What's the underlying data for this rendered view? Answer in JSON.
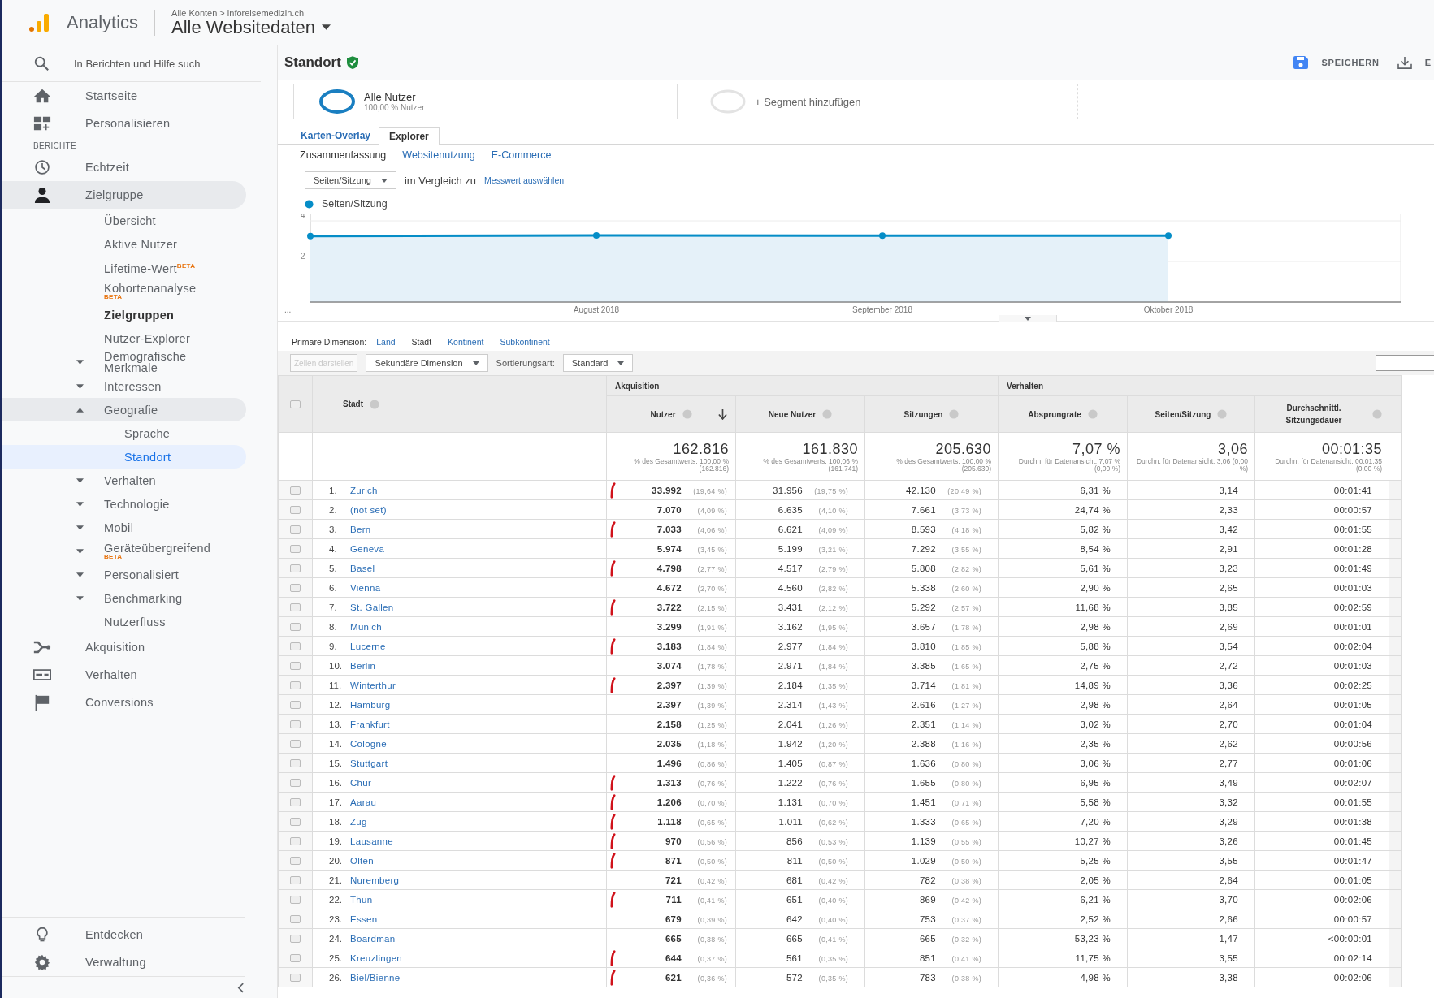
{
  "header": {
    "product": "Analytics",
    "breadcrumb": "Alle Konten > inforeisemedizin.ch",
    "view": "Alle Websitedaten"
  },
  "sidebar": {
    "search_placeholder": "In Berichten und Hilfe such",
    "nav": [
      {
        "kind": "item",
        "label": "Startseite",
        "selected": false
      },
      {
        "kind": "item",
        "label": "Personalisieren",
        "selected": false
      },
      {
        "kind": "section",
        "label": "BERICHTE"
      },
      {
        "kind": "item",
        "label": "Echtzeit",
        "expanded": false,
        "selected": false
      },
      {
        "kind": "item",
        "label": "Zielgruppe",
        "expanded": true,
        "selected": false,
        "children": [
          {
            "label": "Übersicht",
            "selected": false
          },
          {
            "label": "Aktive Nutzer",
            "selected": false
          },
          {
            "label": "Lifetime-Wert$^{BETA}$",
            "selected": false
          },
          {
            "label": "Kohortenanalyse",
            "badge": "BETA",
            "selected": false
          },
          {
            "label": "Zielgruppen",
            "bold": true,
            "selected": false
          },
          {
            "label": "Nutzer-Explorer",
            "selected": false
          },
          {
            "label": "Demografische Merkmale",
            "expanded": false,
            "selected": false
          },
          {
            "label": "Interessen",
            "expanded": false,
            "selected": false
          },
          {
            "label": "Geografie",
            "expanded": true,
            "selected": false,
            "children": [
              {
                "label": "Sprache",
                "selected": false
              },
              {
                "label": "Standort",
                "selected": true
              }
            ]
          },
          {
            "label": "Verhalten",
            "expanded": false,
            "selected": false
          },
          {
            "label": "Technologie",
            "expanded": false,
            "selected": false
          },
          {
            "label": "Mobil",
            "expanded": false,
            "selected": false
          },
          {
            "label": "Geräteübergreifend",
            "badge": "BETA",
            "expanded": false,
            "selected": false
          },
          {
            "label": "Personalisiert",
            "expanded": false,
            "selected": false
          },
          {
            "label": "Benchmarking",
            "expanded": false,
            "selected": false
          },
          {
            "label": "Nutzerfluss",
            "selected": false
          }
        ]
      },
      {
        "kind": "item",
        "label": "Akquisition",
        "expanded": false,
        "selected": false
      },
      {
        "kind": "item",
        "label": "Verhalten",
        "expanded": false,
        "selected": false
      },
      {
        "kind": "item",
        "label": "Conversions",
        "expanded": false,
        "selected": false
      }
    ],
    "bottom": [
      {
        "label": "Entdecken"
      },
      {
        "label": "Verwaltung"
      }
    ]
  },
  "page": {
    "title": "Standort",
    "actions": [
      {
        "label": "SPEICHERN"
      },
      {
        "label": "E"
      }
    ]
  },
  "segments": [
    {
      "kind": "active",
      "label": "Alle Nutzer",
      "sublabel": "100,00 % Nutzer"
    },
    {
      "kind": "add",
      "label": "+ Segment hinzufügen"
    }
  ],
  "view_tabs": [
    {
      "label": "Karten-Overlay",
      "selected": false
    },
    {
      "label": "Explorer",
      "selected": true
    }
  ],
  "sub_tabs": [
    {
      "label": "Zusammenfassung",
      "selected": true
    },
    {
      "label": "Websitenutzung",
      "selected": false
    },
    {
      "label": "E-Commerce",
      "selected": false
    }
  ],
  "metric": {
    "select": "Seiten/Sitzung",
    "compare_text": "im Vergleich zu",
    "compare_link": "Messwert auswählen"
  },
  "chart_data": {
    "type": "area",
    "categories": [
      "...",
      "August 2018",
      "September 2018",
      "Oktober 2018"
    ],
    "ylim": [
      0,
      4.36
    ],
    "yticks": [
      2,
      4
    ],
    "series": [
      {
        "name": "Seiten/Sitzung",
        "color": "#058dc7",
        "marker": true,
        "values": [
          3.25,
          3.28,
          3.27,
          3.27
        ]
      }
    ]
  },
  "primary_dimension": {
    "label": "Primäre Dimension:",
    "options": [
      {
        "label": "Land",
        "selected": false
      },
      {
        "label": "Stadt",
        "selected": true
      },
      {
        "label": "Kontinent",
        "selected": false
      },
      {
        "label": "Subkontinent",
        "selected": false
      }
    ]
  },
  "toolbar": {
    "rows_button": {
      "label": "Zeilen darstellen",
      "disabled": true
    },
    "secondary": "Sekundäre Dimension",
    "sort_label": "Sortierungsart:",
    "sort": "Standard"
  },
  "table": {
    "header_checked": false,
    "dimension": "Stadt",
    "groups": [
      {
        "label": "Akquisition"
      },
      {
        "label": "Verhalten"
      }
    ],
    "columns": [
      {
        "label": "Nutzer",
        "sorted": true
      },
      {
        "label": "Neue Nutzer",
        "sorted": false
      },
      {
        "label": "Sitzungen",
        "sorted": false
      },
      {
        "label": "Absprungrate",
        "sorted": false
      },
      {
        "label": "Seiten/Sitzung",
        "sorted": false
      },
      {
        "label": "Durchschnittl. Sitzungsdauer",
        "sorted": false
      }
    ],
    "totals": [
      {
        "value": "162.816",
        "note": "% des Gesamtwerts: 100,00 % (162.816)"
      },
      {
        "value": "161.830",
        "note": "% des Gesamtwerts: 100,06 % (161.741)"
      },
      {
        "value": "205.630",
        "note": "% des Gesamtwerts: 100,00 % (205.630)"
      },
      {
        "value": "7,07 %",
        "note": "Durchn. für Datenansicht: 7,07 % (0,00 %)"
      },
      {
        "value": "3,06",
        "note": "Durchn. für Datenansicht: 3,06 (0,00 %)"
      },
      {
        "value": "00:01:35",
        "note": "Durchn. für Datenansicht: 00:01:35 (0,00 %)"
      }
    ],
    "rows": [
      {
        "index": "1.",
        "city": "Zurich",
        "users": "33.992",
        "users_pct": "(19,64 %)",
        "new_users": "31.956",
        "new_users_pct": "(19,75 %)",
        "sessions": "42.130",
        "sessions_pct": "(20,49 %)",
        "bounce": "6,31 %",
        "pages": "3,14",
        "duration": "00:01:41",
        "checked": false,
        "marked": true
      },
      {
        "index": "2.",
        "city": "(not set)",
        "users": "7.070",
        "users_pct": "(4,09 %)",
        "new_users": "6.635",
        "new_users_pct": "(4,10 %)",
        "sessions": "7.661",
        "sessions_pct": "(3,73 %)",
        "bounce": "24,74 %",
        "pages": "2,33",
        "duration": "00:00:57",
        "checked": false,
        "marked": false
      },
      {
        "index": "3.",
        "city": "Bern",
        "users": "7.033",
        "users_pct": "(4,06 %)",
        "new_users": "6.621",
        "new_users_pct": "(4,09 %)",
        "sessions": "8.593",
        "sessions_pct": "(4,18 %)",
        "bounce": "5,82 %",
        "pages": "3,42",
        "duration": "00:01:55",
        "checked": false,
        "marked": true
      },
      {
        "index": "4.",
        "city": "Geneva",
        "users": "5.974",
        "users_pct": "(3,45 %)",
        "new_users": "5.199",
        "new_users_pct": "(3,21 %)",
        "sessions": "7.292",
        "sessions_pct": "(3,55 %)",
        "bounce": "8,54 %",
        "pages": "2,91",
        "duration": "00:01:28",
        "checked": false,
        "marked": false
      },
      {
        "index": "5.",
        "city": "Basel",
        "users": "4.798",
        "users_pct": "(2,77 %)",
        "new_users": "4.517",
        "new_users_pct": "(2,79 %)",
        "sessions": "5.808",
        "sessions_pct": "(2,82 %)",
        "bounce": "5,61 %",
        "pages": "3,23",
        "duration": "00:01:49",
        "checked": false,
        "marked": true
      },
      {
        "index": "6.",
        "city": "Vienna",
        "users": "4.672",
        "users_pct": "(2,70 %)",
        "new_users": "4.560",
        "new_users_pct": "(2,82 %)",
        "sessions": "5.338",
        "sessions_pct": "(2,60 %)",
        "bounce": "2,90 %",
        "pages": "2,65",
        "duration": "00:01:03",
        "checked": false,
        "marked": false
      },
      {
        "index": "7.",
        "city": "St. Gallen",
        "users": "3.722",
        "users_pct": "(2,15 %)",
        "new_users": "3.431",
        "new_users_pct": "(2,12 %)",
        "sessions": "5.292",
        "sessions_pct": "(2,57 %)",
        "bounce": "11,68 %",
        "pages": "3,85",
        "duration": "00:02:59",
        "checked": false,
        "marked": true
      },
      {
        "index": "8.",
        "city": "Munich",
        "users": "3.299",
        "users_pct": "(1,91 %)",
        "new_users": "3.162",
        "new_users_pct": "(1,95 %)",
        "sessions": "3.657",
        "sessions_pct": "(1,78 %)",
        "bounce": "2,98 %",
        "pages": "2,69",
        "duration": "00:01:01",
        "checked": false,
        "marked": false
      },
      {
        "index": "9.",
        "city": "Lucerne",
        "users": "3.183",
        "users_pct": "(1,84 %)",
        "new_users": "2.977",
        "new_users_pct": "(1,84 %)",
        "sessions": "3.810",
        "sessions_pct": "(1,85 %)",
        "bounce": "5,88 %",
        "pages": "3,54",
        "duration": "00:02:04",
        "checked": false,
        "marked": true
      },
      {
        "index": "10.",
        "city": "Berlin",
        "users": "3.074",
        "users_pct": "(1,78 %)",
        "new_users": "2.971",
        "new_users_pct": "(1,84 %)",
        "sessions": "3.385",
        "sessions_pct": "(1,65 %)",
        "bounce": "2,75 %",
        "pages": "2,72",
        "duration": "00:01:03",
        "checked": false,
        "marked": false
      },
      {
        "index": "11.",
        "city": "Winterthur",
        "users": "2.397",
        "users_pct": "(1,39 %)",
        "new_users": "2.184",
        "new_users_pct": "(1,35 %)",
        "sessions": "3.714",
        "sessions_pct": "(1,81 %)",
        "bounce": "14,89 %",
        "pages": "3,36",
        "duration": "00:02:25",
        "checked": false,
        "marked": true
      },
      {
        "index": "12.",
        "city": "Hamburg",
        "users": "2.397",
        "users_pct": "(1,39 %)",
        "new_users": "2.314",
        "new_users_pct": "(1,43 %)",
        "sessions": "2.616",
        "sessions_pct": "(1,27 %)",
        "bounce": "2,98 %",
        "pages": "2,64",
        "duration": "00:01:05",
        "checked": false,
        "marked": false
      },
      {
        "index": "13.",
        "city": "Frankfurt",
        "users": "2.158",
        "users_pct": "(1,25 %)",
        "new_users": "2.041",
        "new_users_pct": "(1,26 %)",
        "sessions": "2.351",
        "sessions_pct": "(1,14 %)",
        "bounce": "3,02 %",
        "pages": "2,70",
        "duration": "00:01:04",
        "checked": false,
        "marked": false
      },
      {
        "index": "14.",
        "city": "Cologne",
        "users": "2.035",
        "users_pct": "(1,18 %)",
        "new_users": "1.942",
        "new_users_pct": "(1,20 %)",
        "sessions": "2.388",
        "sessions_pct": "(1,16 %)",
        "bounce": "2,35 %",
        "pages": "2,62",
        "duration": "00:00:56",
        "checked": false,
        "marked": false
      },
      {
        "index": "15.",
        "city": "Stuttgart",
        "users": "1.496",
        "users_pct": "(0,86 %)",
        "new_users": "1.405",
        "new_users_pct": "(0,87 %)",
        "sessions": "1.636",
        "sessions_pct": "(0,80 %)",
        "bounce": "3,06 %",
        "pages": "2,77",
        "duration": "00:01:06",
        "checked": false,
        "marked": false
      },
      {
        "index": "16.",
        "city": "Chur",
        "users": "1.313",
        "users_pct": "(0,76 %)",
        "new_users": "1.222",
        "new_users_pct": "(0,76 %)",
        "sessions": "1.655",
        "sessions_pct": "(0,80 %)",
        "bounce": "6,95 %",
        "pages": "3,49",
        "duration": "00:02:07",
        "checked": false,
        "marked": true
      },
      {
        "index": "17.",
        "city": "Aarau",
        "users": "1.206",
        "users_pct": "(0,70 %)",
        "new_users": "1.131",
        "new_users_pct": "(0,70 %)",
        "sessions": "1.451",
        "sessions_pct": "(0,71 %)",
        "bounce": "5,58 %",
        "pages": "3,32",
        "duration": "00:01:55",
        "checked": false,
        "marked": true
      },
      {
        "index": "18.",
        "city": "Zug",
        "users": "1.118",
        "users_pct": "(0,65 %)",
        "new_users": "1.011",
        "new_users_pct": "(0,62 %)",
        "sessions": "1.333",
        "sessions_pct": "(0,65 %)",
        "bounce": "7,20 %",
        "pages": "3,29",
        "duration": "00:01:38",
        "checked": false,
        "marked": true
      },
      {
        "index": "19.",
        "city": "Lausanne",
        "users": "970",
        "users_pct": "(0,56 %)",
        "new_users": "856",
        "new_users_pct": "(0,53 %)",
        "sessions": "1.139",
        "sessions_pct": "(0,55 %)",
        "bounce": "10,27 %",
        "pages": "3,26",
        "duration": "00:01:45",
        "checked": false,
        "marked": true
      },
      {
        "index": "20.",
        "city": "Olten",
        "users": "871",
        "users_pct": "(0,50 %)",
        "new_users": "811",
        "new_users_pct": "(0,50 %)",
        "sessions": "1.029",
        "sessions_pct": "(0,50 %)",
        "bounce": "5,25 %",
        "pages": "3,55",
        "duration": "00:01:47",
        "checked": false,
        "marked": true
      },
      {
        "index": "21.",
        "city": "Nuremberg",
        "users": "721",
        "users_pct": "(0,42 %)",
        "new_users": "681",
        "new_users_pct": "(0,42 %)",
        "sessions": "782",
        "sessions_pct": "(0,38 %)",
        "bounce": "2,05 %",
        "pages": "2,64",
        "duration": "00:01:05",
        "checked": false,
        "marked": false
      },
      {
        "index": "22.",
        "city": "Thun",
        "users": "711",
        "users_pct": "(0,41 %)",
        "new_users": "651",
        "new_users_pct": "(0,40 %)",
        "sessions": "869",
        "sessions_pct": "(0,42 %)",
        "bounce": "6,21 %",
        "pages": "3,70",
        "duration": "00:02:06",
        "checked": false,
        "marked": true
      },
      {
        "index": "23.",
        "city": "Essen",
        "users": "679",
        "users_pct": "(0,39 %)",
        "new_users": "642",
        "new_users_pct": "(0,40 %)",
        "sessions": "753",
        "sessions_pct": "(0,37 %)",
        "bounce": "2,52 %",
        "pages": "2,66",
        "duration": "00:00:57",
        "checked": false,
        "marked": false
      },
      {
        "index": "24.",
        "city": "Boardman",
        "users": "665",
        "users_pct": "(0,38 %)",
        "new_users": "665",
        "new_users_pct": "(0,41 %)",
        "sessions": "665",
        "sessions_pct": "(0,32 %)",
        "bounce": "53,23 %",
        "pages": "1,47",
        "duration": "<00:00:01",
        "checked": false,
        "marked": false
      },
      {
        "index": "25.",
        "city": "Kreuzlingen",
        "users": "644",
        "users_pct": "(0,37 %)",
        "new_users": "561",
        "new_users_pct": "(0,35 %)",
        "sessions": "851",
        "sessions_pct": "(0,41 %)",
        "bounce": "11,75 %",
        "pages": "3,55",
        "duration": "00:02:14",
        "checked": false,
        "marked": true
      },
      {
        "index": "26.",
        "city": "Biel/Bienne",
        "users": "621",
        "users_pct": "(0,36 %)",
        "new_users": "572",
        "new_users_pct": "(0,35 %)",
        "sessions": "783",
        "sessions_pct": "(0,38 %)",
        "bounce": "4,98 %",
        "pages": "3,38",
        "duration": "00:02:06",
        "checked": false,
        "marked": true
      }
    ]
  }
}
